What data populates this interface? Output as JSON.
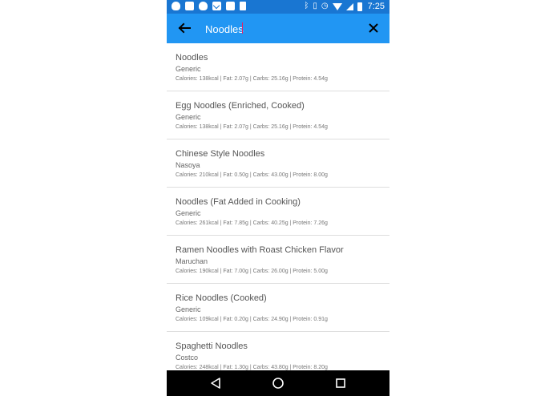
{
  "status_bar": {
    "time": "7:25",
    "icons": [
      "snapchat-icon",
      "ticket-icon",
      "snapchat-icon",
      "gmail-icon",
      "image-icon",
      "phone-icon",
      "bluetooth-icon",
      "vibrate-icon",
      "alarm-icon",
      "wifi-icon",
      "signal-icon",
      "battery-icon"
    ]
  },
  "toolbar": {
    "search_value": "Noodles",
    "back_icon": "arrow-back-icon",
    "clear_icon": "close-icon",
    "color": "#2196F3"
  },
  "results": [
    {
      "name": "Noodles",
      "brand": "Generic",
      "nutrition": "Calories: 138kcal | Fat: 2.07g | Carbs: 25.16g | Protein: 4.54g"
    },
    {
      "name": "Egg Noodles (Enriched, Cooked)",
      "brand": "Generic",
      "nutrition": "Calories: 138kcal | Fat: 2.07g | Carbs: 25.16g | Protein: 4.54g"
    },
    {
      "name": "Chinese Style Noodles",
      "brand": "Nasoya",
      "nutrition": "Calories: 210kcal | Fat: 0.50g | Carbs: 43.00g | Protein: 8.00g"
    },
    {
      "name": "Noodles (Fat Added in Cooking)",
      "brand": "Generic",
      "nutrition": "Calories: 261kcal | Fat: 7.85g | Carbs: 40.25g | Protein: 7.26g"
    },
    {
      "name": "Ramen Noodles with Roast Chicken Flavor",
      "brand": "Maruchan",
      "nutrition": "Calories: 190kcal | Fat: 7.00g | Carbs: 26.00g | Protein: 5.00g"
    },
    {
      "name": "Rice Noodles (Cooked)",
      "brand": "Generic",
      "nutrition": "Calories: 109kcal | Fat: 0.20g | Carbs: 24.90g | Protein: 0.91g"
    },
    {
      "name": "Spaghetti Noodles",
      "brand": "Costco",
      "nutrition": "Calories: 248kcal | Fat: 1.30g | Carbs: 43.80g | Protein: 8.20g"
    }
  ],
  "nav_bar": {
    "icons": [
      "nav-back-icon",
      "nav-home-icon",
      "nav-recents-icon"
    ]
  }
}
